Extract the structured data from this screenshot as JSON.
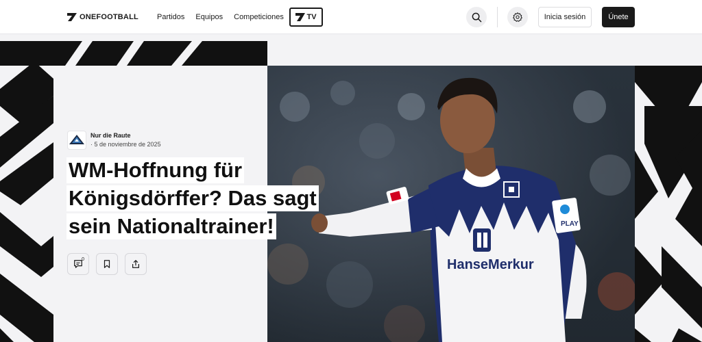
{
  "header": {
    "logo_text": "ONEFOOTBALL",
    "nav": [
      {
        "label": "Partidos"
      },
      {
        "label": "Equipos"
      },
      {
        "label": "Competiciones"
      }
    ],
    "tv_label": "TV",
    "login_label": "Inicia sesión",
    "join_label": "Únete"
  },
  "article": {
    "source_name": "Nur die Raute",
    "date": "5 de noviembre de 2025",
    "headline_lines": [
      "WM-Hoffnung für",
      "Königsdörffer? Das sagt",
      "sein Nationaltrainer!"
    ],
    "comment_count": "0"
  },
  "photo": {
    "jersey_sponsor": "HanseMerkur",
    "sleeve_badge": "PLAY"
  },
  "colors": {
    "accent": "#1a1a1a",
    "background": "#f3f3f5",
    "jersey_blue": "#1f2e6b"
  },
  "icons": [
    "onefootball-logo-icon",
    "search-icon",
    "gear-icon",
    "comment-icon",
    "bookmark-icon",
    "share-icon"
  ]
}
